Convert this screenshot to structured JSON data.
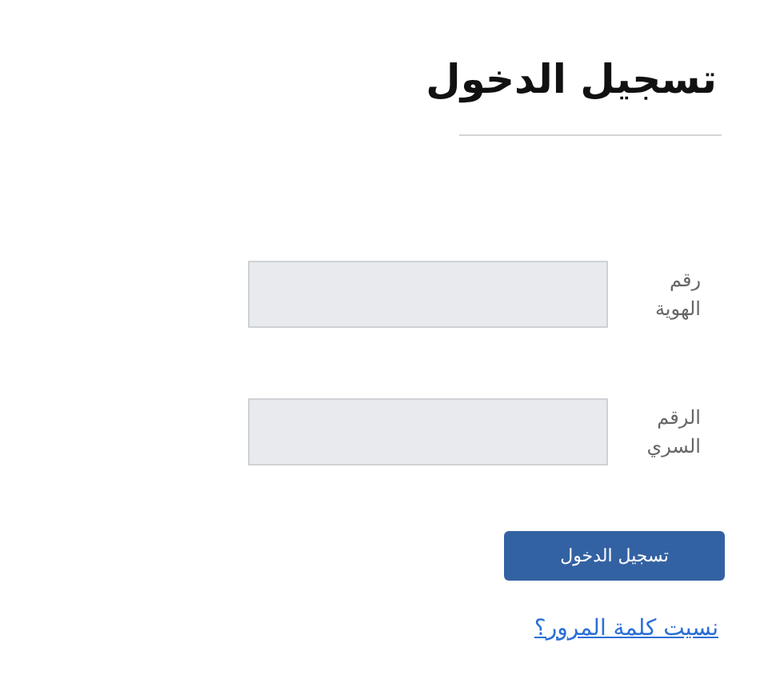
{
  "title": "تسجيل الدخول",
  "fields": [
    {
      "label": "رقم الهوية"
    },
    {
      "label": "الرقم السري"
    }
  ],
  "submit_button": "تسجيل الدخول",
  "forgot_link": "نسيت كلمة المرور؟"
}
